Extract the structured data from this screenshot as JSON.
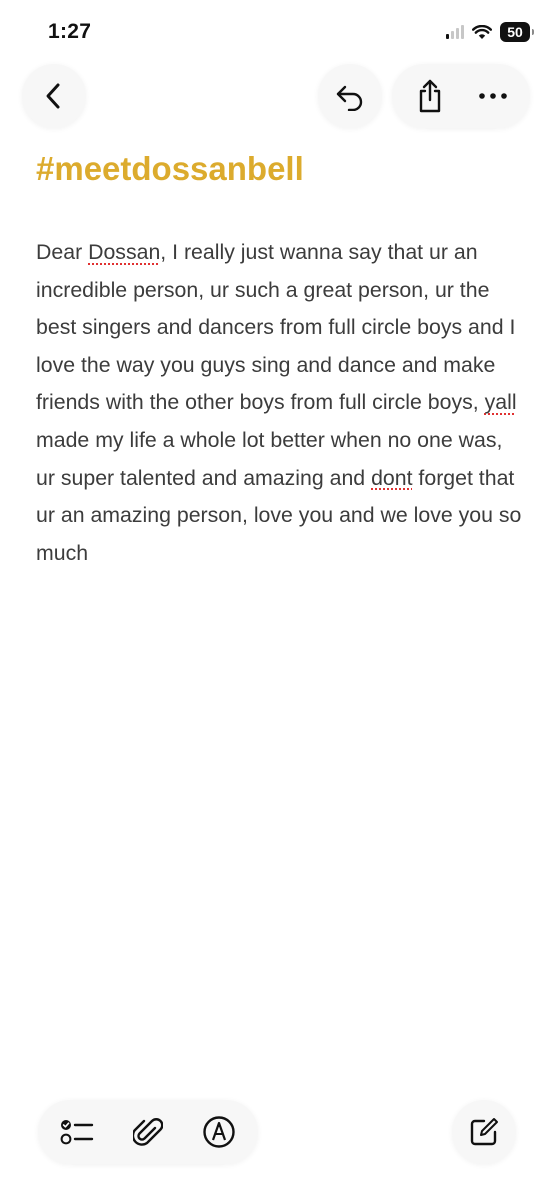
{
  "status_bar": {
    "time": "1:27",
    "battery": "50",
    "icons": [
      "cellular-signal-icon",
      "wifi-icon",
      "battery-icon"
    ]
  },
  "toolbar": {
    "icons": [
      "back-chevron-icon",
      "undo-icon",
      "share-icon",
      "more-ellipsis-icon"
    ]
  },
  "note": {
    "title": "#meetdossanbell",
    "body_parts": [
      "Dear ",
      "Dossan",
      ", I really just wanna say that ur an incredible person, ur such a great person, ur the best singers and dancers from full circle boys and I love the way you guys sing and dance and make friends with the other boys from full circle boys, ",
      "yall",
      " made my life a whole lot better when no one was, ur super talented and amazing and ",
      "dont",
      " forget that ur an amazing person, love you and we love you so much"
    ]
  },
  "bottom_toolbar": {
    "icons": [
      "checklist-icon",
      "paperclip-icon",
      "markup-pen-icon",
      "compose-icon"
    ]
  },
  "colors": {
    "title": "#dcab2d",
    "body_text": "#3c3c3c",
    "spellcheck_underline": "#e03131",
    "button_bg": "#f7f7f7"
  }
}
